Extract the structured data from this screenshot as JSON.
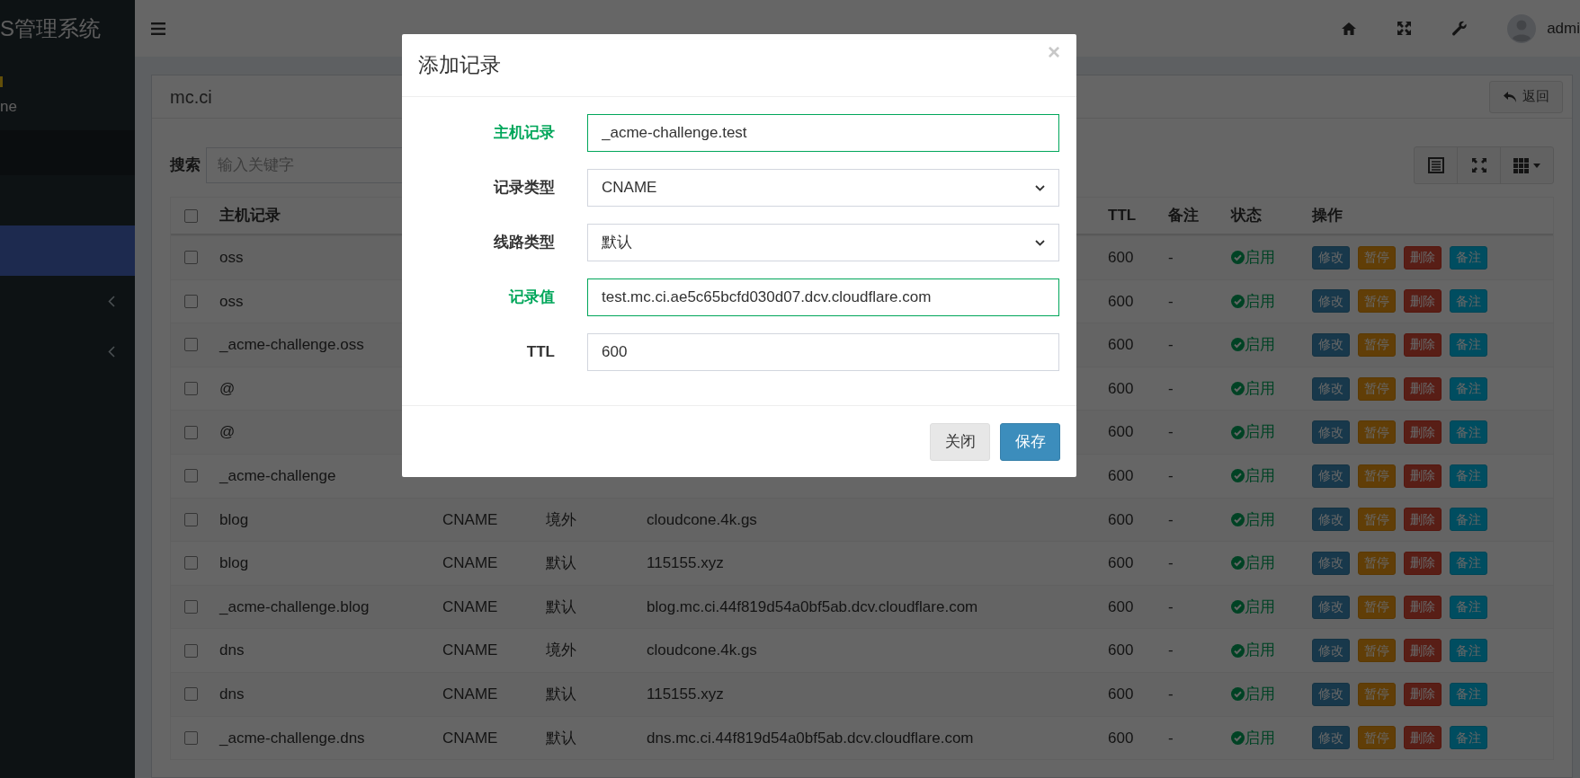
{
  "sidebar": {
    "title": "S管理系统",
    "user_status": "ne",
    "items": [
      {
        "selected": false,
        "expandable": false
      },
      {
        "selected": true,
        "expandable": false
      },
      {
        "selected": false,
        "expandable": true
      },
      {
        "selected": false,
        "expandable": true
      }
    ]
  },
  "header": {
    "user": "admi"
  },
  "panel": {
    "title": "mc.ci",
    "back_button": "返回",
    "search": {
      "label": "搜索",
      "placeholder": "输入关键字"
    }
  },
  "table": {
    "select_all": {
      "checked": false
    },
    "columns": [
      {
        "label": "主机记录"
      },
      {
        "label": "TTL"
      },
      {
        "label": "备注"
      },
      {
        "label": "状态"
      },
      {
        "label": "操作"
      }
    ],
    "rows": [
      {
        "checked": false,
        "name": "oss",
        "ttl": "600",
        "remark": "-",
        "status": "启用",
        "enabled": true,
        "actions": [
          {
            "kind": "edit",
            "label": "修改"
          },
          {
            "kind": "pause",
            "label": "暂停"
          },
          {
            "kind": "delete",
            "label": "删除"
          },
          {
            "kind": "note",
            "label": "备注"
          }
        ]
      },
      {
        "checked": false,
        "name": "oss",
        "ttl": "600",
        "remark": "-",
        "status": "启用",
        "enabled": true,
        "actions": [
          {
            "kind": "edit",
            "label": "修改"
          },
          {
            "kind": "pause",
            "label": "暂停"
          },
          {
            "kind": "delete",
            "label": "删除"
          },
          {
            "kind": "note",
            "label": "备注"
          }
        ]
      },
      {
        "checked": false,
        "name": "_acme-challenge.oss",
        "ttl": "600",
        "remark": "-",
        "status": "启用",
        "enabled": true,
        "actions": [
          {
            "kind": "edit",
            "label": "修改"
          },
          {
            "kind": "pause",
            "label": "暂停"
          },
          {
            "kind": "delete",
            "label": "删除"
          },
          {
            "kind": "note",
            "label": "备注"
          }
        ]
      },
      {
        "checked": false,
        "name": "@",
        "ttl": "600",
        "remark": "-",
        "status": "启用",
        "enabled": true,
        "actions": [
          {
            "kind": "edit",
            "label": "修改"
          },
          {
            "kind": "pause",
            "label": "暂停"
          },
          {
            "kind": "delete",
            "label": "删除"
          },
          {
            "kind": "note",
            "label": "备注"
          }
        ]
      },
      {
        "checked": false,
        "name": "@",
        "ttl": "600",
        "remark": "-",
        "status": "启用",
        "enabled": true,
        "actions": [
          {
            "kind": "edit",
            "label": "修改"
          },
          {
            "kind": "pause",
            "label": "暂停"
          },
          {
            "kind": "delete",
            "label": "删除"
          },
          {
            "kind": "note",
            "label": "备注"
          }
        ]
      },
      {
        "checked": false,
        "name": "_acme-challenge",
        "ttl": "600",
        "remark": "-",
        "status": "启用",
        "enabled": true,
        "actions": [
          {
            "kind": "edit",
            "label": "修改"
          },
          {
            "kind": "pause",
            "label": "暂停"
          },
          {
            "kind": "delete",
            "label": "删除"
          },
          {
            "kind": "note",
            "label": "备注"
          }
        ]
      },
      {
        "checked": false,
        "name": "blog",
        "type": "CNAME",
        "line": "境外",
        "value": "cloudcone.4k.gs",
        "ttl": "600",
        "remark": "-",
        "status": "启用",
        "enabled": true,
        "actions": [
          {
            "kind": "edit",
            "label": "修改"
          },
          {
            "kind": "pause",
            "label": "暂停"
          },
          {
            "kind": "delete",
            "label": "删除"
          },
          {
            "kind": "note",
            "label": "备注"
          }
        ]
      },
      {
        "checked": false,
        "name": "blog",
        "type": "CNAME",
        "line": "默认",
        "value": "115155.xyz",
        "ttl": "600",
        "remark": "-",
        "status": "启用",
        "enabled": true,
        "actions": [
          {
            "kind": "edit",
            "label": "修改"
          },
          {
            "kind": "pause",
            "label": "暂停"
          },
          {
            "kind": "delete",
            "label": "删除"
          },
          {
            "kind": "note",
            "label": "备注"
          }
        ]
      },
      {
        "checked": false,
        "name": "_acme-challenge.blog",
        "type": "CNAME",
        "line": "默认",
        "value": "blog.mc.ci.44f819d54a0bf5ab.dcv.cloudflare.com",
        "ttl": "600",
        "remark": "-",
        "status": "启用",
        "enabled": true,
        "actions": [
          {
            "kind": "edit",
            "label": "修改"
          },
          {
            "kind": "pause",
            "label": "暂停"
          },
          {
            "kind": "delete",
            "label": "删除"
          },
          {
            "kind": "note",
            "label": "备注"
          }
        ]
      },
      {
        "checked": false,
        "name": "dns",
        "type": "CNAME",
        "line": "境外",
        "value": "cloudcone.4k.gs",
        "ttl": "600",
        "remark": "-",
        "status": "启用",
        "enabled": true,
        "actions": [
          {
            "kind": "edit",
            "label": "修改"
          },
          {
            "kind": "pause",
            "label": "暂停"
          },
          {
            "kind": "delete",
            "label": "删除"
          },
          {
            "kind": "note",
            "label": "备注"
          }
        ]
      },
      {
        "checked": false,
        "name": "dns",
        "type": "CNAME",
        "line": "默认",
        "value": "115155.xyz",
        "ttl": "600",
        "remark": "-",
        "status": "启用",
        "enabled": true,
        "actions": [
          {
            "kind": "edit",
            "label": "修改"
          },
          {
            "kind": "pause",
            "label": "暂停"
          },
          {
            "kind": "delete",
            "label": "删除"
          },
          {
            "kind": "note",
            "label": "备注"
          }
        ]
      },
      {
        "checked": false,
        "name": "_acme-challenge.dns",
        "type": "CNAME",
        "line": "默认",
        "value": "dns.mc.ci.44f819d54a0bf5ab.dcv.cloudflare.com",
        "ttl": "600",
        "remark": "-",
        "status": "启用",
        "enabled": true,
        "actions": [
          {
            "kind": "edit",
            "label": "修改"
          },
          {
            "kind": "pause",
            "label": "暂停"
          },
          {
            "kind": "delete",
            "label": "删除"
          },
          {
            "kind": "note",
            "label": "备注"
          }
        ]
      }
    ]
  },
  "modal": {
    "title": "添加记录",
    "close": "×",
    "fields": [
      {
        "label": "主机记录",
        "kind": "input",
        "value": "_acme-challenge.test",
        "success": true
      },
      {
        "label": "记录类型",
        "kind": "select",
        "value": "CNAME",
        "success": false
      },
      {
        "label": "线路类型",
        "kind": "select",
        "value": "默认",
        "success": false
      },
      {
        "label": "记录值",
        "kind": "input",
        "value": "test.mc.ci.ae5c65bcfd030d07.dcv.cloudflare.com",
        "success": true
      },
      {
        "label": "TTL",
        "kind": "input",
        "value": "600",
        "success": false
      }
    ],
    "buttons": [
      {
        "kind": "default",
        "label": "关闭"
      },
      {
        "kind": "primary",
        "label": "保存"
      }
    ]
  }
}
